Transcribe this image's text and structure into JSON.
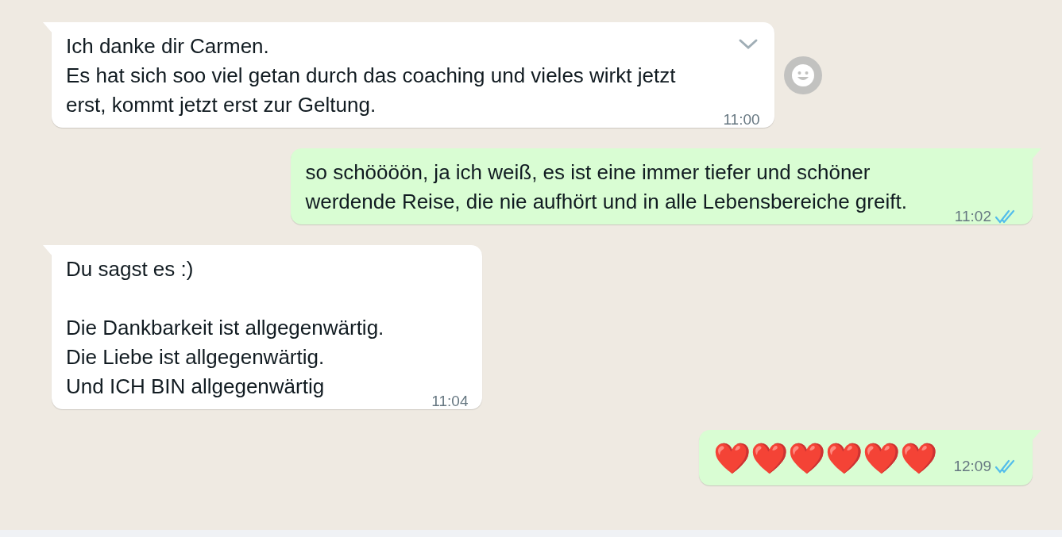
{
  "messages": [
    {
      "kind": "incoming",
      "text": "Ich danke dir Carmen.\nEs hat sich soo viel getan durch das coaching und vieles wirkt jetzt\nerst, kommt jetzt erst zur Geltung.",
      "time": "11:00",
      "menu_chevron": true,
      "reaction_button": true
    },
    {
      "kind": "outgoing",
      "text": "so schöööön, ja ich weiß, es ist eine immer tiefer und schöner\nwerdende Reise, die nie aufhört und in alle Lebensbereiche greift.",
      "time": "11:02",
      "read": true
    },
    {
      "kind": "incoming",
      "text": "Du sagst es :)\n\nDie Dankbarkeit ist allgegenwärtig.\nDie Liebe ist allgegenwärtig.\nUnd ICH BIN allgegenwärtig",
      "time": "11:04",
      "menu_chevron": false,
      "reaction_button": false
    },
    {
      "kind": "emoji",
      "text": "❤️❤️❤️❤️❤️❤️",
      "time": "12:09",
      "read": true
    }
  ]
}
